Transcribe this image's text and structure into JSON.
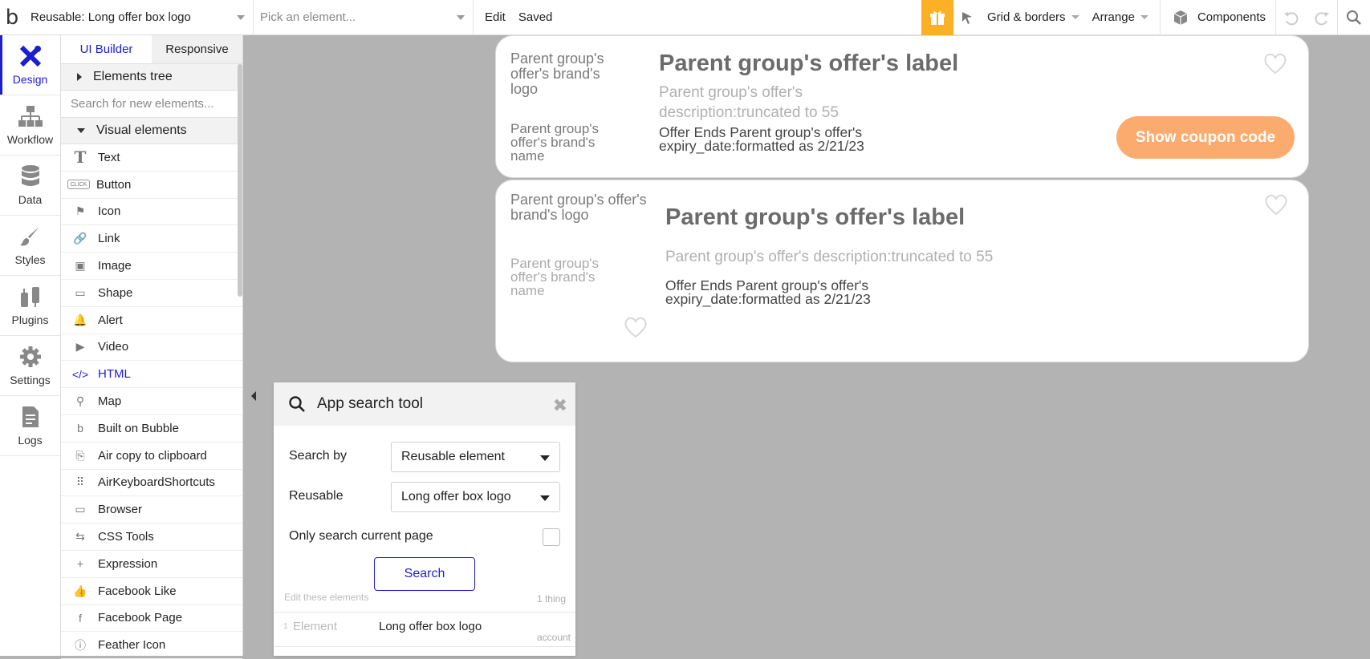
{
  "topbar": {
    "reusable_select": "Reusable: Long offer box logo",
    "element_select_placeholder": "Pick an element...",
    "edit": "Edit",
    "saved": "Saved",
    "grid_borders": "Grid & borders",
    "arrange": "Arrange",
    "components": "Components"
  },
  "leftnav": [
    {
      "label": "Design",
      "icon": "design-icon"
    },
    {
      "label": "Workflow",
      "icon": "workflow-icon"
    },
    {
      "label": "Data",
      "icon": "database-icon"
    },
    {
      "label": "Styles",
      "icon": "brush-icon"
    },
    {
      "label": "Plugins",
      "icon": "plug-icon"
    },
    {
      "label": "Settings",
      "icon": "gear-icon"
    },
    {
      "label": "Logs",
      "icon": "document-icon"
    }
  ],
  "panel": {
    "tabs": [
      "UI Builder",
      "Responsive"
    ],
    "elements_tree": "Elements tree",
    "search_placeholder": "Search for new elements...",
    "visual_elements": "Visual elements",
    "items": [
      {
        "label": "Text",
        "icon": "T"
      },
      {
        "label": "Button",
        "icon": "CLICK"
      },
      {
        "label": "Icon",
        "icon": "⚑"
      },
      {
        "label": "Link",
        "icon": "🔗"
      },
      {
        "label": "Image",
        "icon": "▣"
      },
      {
        "label": "Shape",
        "icon": "▭"
      },
      {
        "label": "Alert",
        "icon": "🔔"
      },
      {
        "label": "Video",
        "icon": "▶"
      },
      {
        "label": "HTML",
        "icon": "</>"
      },
      {
        "label": "Map",
        "icon": "⚲"
      },
      {
        "label": "Built on Bubble",
        "icon": "b"
      },
      {
        "label": "Air copy to clipboard",
        "icon": "⎘"
      },
      {
        "label": "AirKeyboardShortcuts",
        "icon": "⠿"
      },
      {
        "label": "Browser",
        "icon": "▭"
      },
      {
        "label": "CSS Tools",
        "icon": "⇆"
      },
      {
        "label": "Expression",
        "icon": "+"
      },
      {
        "label": "Facebook Like",
        "icon": "👍"
      },
      {
        "label": "Facebook Page",
        "icon": "f"
      },
      {
        "label": "Feather Icon",
        "icon": "ⓘ"
      }
    ]
  },
  "card1": {
    "brand_logo": "Parent group's offer's brand's logo",
    "brand_name": "Parent group's offer's brand's name",
    "label": "Parent group's offer's label",
    "description": "Parent group's offer's description:truncated to 55",
    "expiry": "Offer Ends Parent group's offer's expiry_date:formatted as 2/21/23",
    "coupon_button": "Show coupon code"
  },
  "card2": {
    "brand_logo": "Parent group's offer's brand's logo",
    "brand_name": "Parent group's offer's brand's name",
    "label": "Parent group's offer's label",
    "description": "Parent group's offer's description:truncated to 55",
    "expiry": "Offer Ends Parent group's offer's expiry_date:formatted as 2/21/23"
  },
  "search_tool": {
    "title": "App search tool",
    "search_by_label": "Search by",
    "search_by_value": "Reusable element",
    "reusable_label": "Reusable",
    "reusable_value": "Long offer box logo",
    "only_current_page": "Only search current page",
    "search_button": "Search",
    "edit_these": "Edit these elements",
    "count": "1 thing",
    "result_index": "1",
    "result_type": "Element",
    "result_name": "Long offer box logo",
    "result_page": "account"
  },
  "colors": {
    "accent": "#1e1ed1",
    "gift": "#fbb026",
    "coupon": "#fbab6e",
    "canvas": "#b3b3b3"
  }
}
